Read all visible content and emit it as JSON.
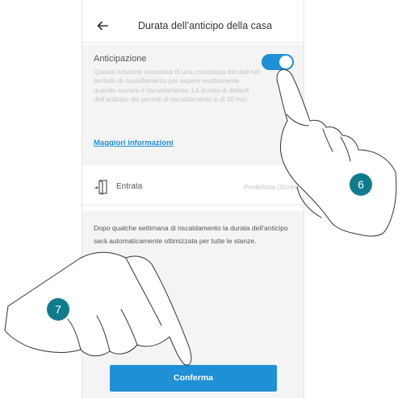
{
  "header": {
    "title": "Durata dell’anticipo della casa",
    "back_icon": "arrow-left-icon"
  },
  "anticipation": {
    "label": "Anticipazione",
    "toggle_on": true,
    "description": "Questa funzione necessita di una cronologia dei dati nel periodo di riscaldamento per sapere esattamente quando avviare il riscaldamento. La durata di default dell’anticipo dei periodi di riscaldamento è di 30 min.",
    "more_link": "Maggiori informazioni"
  },
  "entry_row": {
    "icon": "door-icon",
    "label": "Entrata",
    "value": "Predefinita (30min)"
  },
  "info_text": "Dopo qualche settimana di riscaldamento la durata dell’anticipo sarà automaticamente ottimizzata per tutte le stanze.",
  "confirm_label": "Conferma",
  "steps": {
    "toggle_step": "6",
    "confirm_step": "7"
  },
  "colors": {
    "accent": "#1f8fd6",
    "step_badge": "#117b8e"
  }
}
